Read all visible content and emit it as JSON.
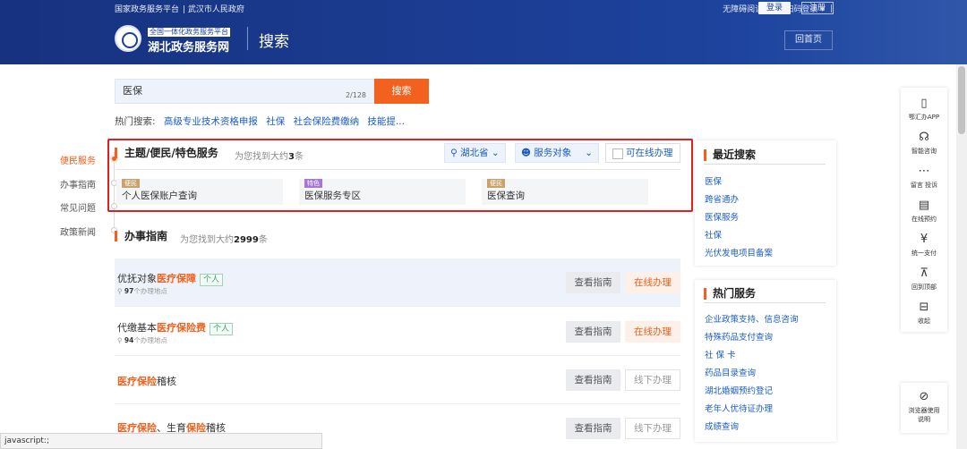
{
  "header": {
    "top_links": [
      "国家政务服务平台",
      "武汉市人民政府"
    ],
    "accessibility": "无障碍阅读",
    "scan_login": "扫码登录",
    "login": "登录",
    "register": "注册",
    "logo_small": "全国一体化政务服务平台",
    "logo_big": "湖北政务服务网",
    "page_title": "搜索",
    "home_button": "回首页"
  },
  "search": {
    "value": "医保",
    "count": "2/128",
    "button": "搜索",
    "hot_label": "热门搜索:",
    "hot_items": [
      "高级专业技术资格申报",
      "社保",
      "社会保险费缴纳",
      "技能提..."
    ]
  },
  "leftnav": {
    "items": [
      "便民服务",
      "办事指南",
      "常见问题",
      "政策新闻"
    ]
  },
  "theme_section": {
    "title": "主题/便民/特色服务",
    "found_prefix": "为您找到大约",
    "found_count": "3",
    "found_suffix": "条",
    "region": "湖北省",
    "audience": "服务对象",
    "online_only": "可在线办理",
    "cards": [
      {
        "tag": "便民",
        "name": "个人医保账户查询",
        "tag_color": "#c9a26b"
      },
      {
        "tag": "特色",
        "name": "医保服务专区",
        "tag_color": "#a677d6"
      },
      {
        "tag": "便民",
        "name": "医保查询",
        "tag_color": "#c9a26b"
      }
    ]
  },
  "guide_section": {
    "title": "办事指南",
    "found_prefix": "为您找到大约",
    "found_count": "2999",
    "found_suffix": "条",
    "view_label": "查看指南",
    "rows": [
      {
        "pre": "优抚对象",
        "hl": "医疗保障",
        "post": "",
        "hl2": "",
        "post2": "",
        "tag": "个人",
        "locations": "97",
        "loc_suffix": "个办理地点",
        "action": "在线办理",
        "online": true
      },
      {
        "pre": "代缴基本",
        "hl": "医疗保险费",
        "post": "",
        "hl2": "",
        "post2": "",
        "tag": "个人",
        "locations": "94",
        "loc_suffix": "个办理地点",
        "action": "在线办理",
        "online": true
      },
      {
        "pre": "",
        "hl": "医疗保险",
        "post": "稽核",
        "hl2": "",
        "post2": "",
        "tag": "",
        "locations": "",
        "loc_suffix": "",
        "action": "线下办理",
        "online": false
      },
      {
        "pre": "",
        "hl": "医疗保险",
        "post": "、生育",
        "hl2": "保险",
        "post2": "稽核",
        "tag": "",
        "locations": "",
        "loc_suffix": "",
        "action": "线下办理",
        "online": false
      }
    ]
  },
  "recent_search": {
    "title": "最近搜索",
    "items": [
      "医保",
      "跨省通办",
      "医保服务",
      "社保",
      "光伏发电项目备案"
    ]
  },
  "hot_services": {
    "title": "热门服务",
    "items": [
      "企业政策支持、信息咨询",
      "特殊药品支付查询",
      "社 保 卡",
      "药品目录查询",
      "湖北婚姻预约登记",
      "老年人优待证办理",
      "成绩查询"
    ]
  },
  "toolbar": {
    "items": [
      {
        "icon": "▯",
        "label": "鄂汇办APP"
      },
      {
        "icon": "☊",
        "label": "智能咨询"
      },
      {
        "icon": "⋯",
        "label": "留言 投诉"
      },
      {
        "icon": "▤",
        "label": "在线预约"
      },
      {
        "icon": "¥",
        "label": "统一支付"
      },
      {
        "icon": "⊼",
        "label": "回到顶部"
      },
      {
        "icon": "⊟",
        "label": "收起"
      }
    ],
    "browser_icon": "⊘",
    "browser_label": "浏览器使用说明"
  },
  "status_bar": "javascript:;",
  "colors": {
    "brand": "#1c3f97",
    "accent": "#f2611d",
    "link": "#1b5cc7",
    "highlight_border": "#e02020"
  }
}
